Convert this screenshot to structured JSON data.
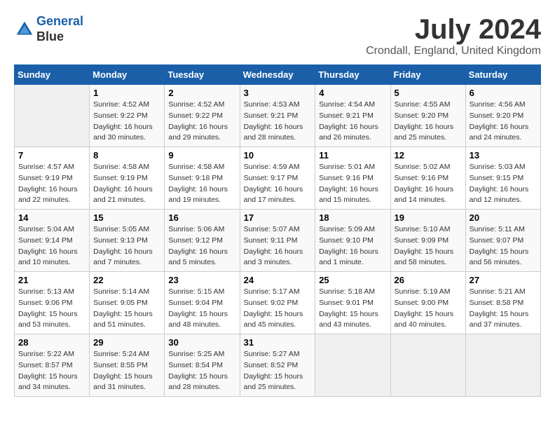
{
  "header": {
    "logo_line1": "General",
    "logo_line2": "Blue",
    "title": "July 2024",
    "location": "Crondall, England, United Kingdom"
  },
  "days_of_week": [
    "Sunday",
    "Monday",
    "Tuesday",
    "Wednesday",
    "Thursday",
    "Friday",
    "Saturday"
  ],
  "weeks": [
    [
      {
        "day": "",
        "empty": true
      },
      {
        "day": "1",
        "sunrise": "Sunrise: 4:52 AM",
        "sunset": "Sunset: 9:22 PM",
        "daylight": "Daylight: 16 hours and 30 minutes."
      },
      {
        "day": "2",
        "sunrise": "Sunrise: 4:52 AM",
        "sunset": "Sunset: 9:22 PM",
        "daylight": "Daylight: 16 hours and 29 minutes."
      },
      {
        "day": "3",
        "sunrise": "Sunrise: 4:53 AM",
        "sunset": "Sunset: 9:21 PM",
        "daylight": "Daylight: 16 hours and 28 minutes."
      },
      {
        "day": "4",
        "sunrise": "Sunrise: 4:54 AM",
        "sunset": "Sunset: 9:21 PM",
        "daylight": "Daylight: 16 hours and 26 minutes."
      },
      {
        "day": "5",
        "sunrise": "Sunrise: 4:55 AM",
        "sunset": "Sunset: 9:20 PM",
        "daylight": "Daylight: 16 hours and 25 minutes."
      },
      {
        "day": "6",
        "sunrise": "Sunrise: 4:56 AM",
        "sunset": "Sunset: 9:20 PM",
        "daylight": "Daylight: 16 hours and 24 minutes."
      }
    ],
    [
      {
        "day": "7",
        "sunrise": "Sunrise: 4:57 AM",
        "sunset": "Sunset: 9:19 PM",
        "daylight": "Daylight: 16 hours and 22 minutes."
      },
      {
        "day": "8",
        "sunrise": "Sunrise: 4:58 AM",
        "sunset": "Sunset: 9:19 PM",
        "daylight": "Daylight: 16 hours and 21 minutes."
      },
      {
        "day": "9",
        "sunrise": "Sunrise: 4:58 AM",
        "sunset": "Sunset: 9:18 PM",
        "daylight": "Daylight: 16 hours and 19 minutes."
      },
      {
        "day": "10",
        "sunrise": "Sunrise: 4:59 AM",
        "sunset": "Sunset: 9:17 PM",
        "daylight": "Daylight: 16 hours and 17 minutes."
      },
      {
        "day": "11",
        "sunrise": "Sunrise: 5:01 AM",
        "sunset": "Sunset: 9:16 PM",
        "daylight": "Daylight: 16 hours and 15 minutes."
      },
      {
        "day": "12",
        "sunrise": "Sunrise: 5:02 AM",
        "sunset": "Sunset: 9:16 PM",
        "daylight": "Daylight: 16 hours and 14 minutes."
      },
      {
        "day": "13",
        "sunrise": "Sunrise: 5:03 AM",
        "sunset": "Sunset: 9:15 PM",
        "daylight": "Daylight: 16 hours and 12 minutes."
      }
    ],
    [
      {
        "day": "14",
        "sunrise": "Sunrise: 5:04 AM",
        "sunset": "Sunset: 9:14 PM",
        "daylight": "Daylight: 16 hours and 10 minutes."
      },
      {
        "day": "15",
        "sunrise": "Sunrise: 5:05 AM",
        "sunset": "Sunset: 9:13 PM",
        "daylight": "Daylight: 16 hours and 7 minutes."
      },
      {
        "day": "16",
        "sunrise": "Sunrise: 5:06 AM",
        "sunset": "Sunset: 9:12 PM",
        "daylight": "Daylight: 16 hours and 5 minutes."
      },
      {
        "day": "17",
        "sunrise": "Sunrise: 5:07 AM",
        "sunset": "Sunset: 9:11 PM",
        "daylight": "Daylight: 16 hours and 3 minutes."
      },
      {
        "day": "18",
        "sunrise": "Sunrise: 5:09 AM",
        "sunset": "Sunset: 9:10 PM",
        "daylight": "Daylight: 16 hours and 1 minute."
      },
      {
        "day": "19",
        "sunrise": "Sunrise: 5:10 AM",
        "sunset": "Sunset: 9:09 PM",
        "daylight": "Daylight: 15 hours and 58 minutes."
      },
      {
        "day": "20",
        "sunrise": "Sunrise: 5:11 AM",
        "sunset": "Sunset: 9:07 PM",
        "daylight": "Daylight: 15 hours and 56 minutes."
      }
    ],
    [
      {
        "day": "21",
        "sunrise": "Sunrise: 5:13 AM",
        "sunset": "Sunset: 9:06 PM",
        "daylight": "Daylight: 15 hours and 53 minutes."
      },
      {
        "day": "22",
        "sunrise": "Sunrise: 5:14 AM",
        "sunset": "Sunset: 9:05 PM",
        "daylight": "Daylight: 15 hours and 51 minutes."
      },
      {
        "day": "23",
        "sunrise": "Sunrise: 5:15 AM",
        "sunset": "Sunset: 9:04 PM",
        "daylight": "Daylight: 15 hours and 48 minutes."
      },
      {
        "day": "24",
        "sunrise": "Sunrise: 5:17 AM",
        "sunset": "Sunset: 9:02 PM",
        "daylight": "Daylight: 15 hours and 45 minutes."
      },
      {
        "day": "25",
        "sunrise": "Sunrise: 5:18 AM",
        "sunset": "Sunset: 9:01 PM",
        "daylight": "Daylight: 15 hours and 43 minutes."
      },
      {
        "day": "26",
        "sunrise": "Sunrise: 5:19 AM",
        "sunset": "Sunset: 9:00 PM",
        "daylight": "Daylight: 15 hours and 40 minutes."
      },
      {
        "day": "27",
        "sunrise": "Sunrise: 5:21 AM",
        "sunset": "Sunset: 8:58 PM",
        "daylight": "Daylight: 15 hours and 37 minutes."
      }
    ],
    [
      {
        "day": "28",
        "sunrise": "Sunrise: 5:22 AM",
        "sunset": "Sunset: 8:57 PM",
        "daylight": "Daylight: 15 hours and 34 minutes."
      },
      {
        "day": "29",
        "sunrise": "Sunrise: 5:24 AM",
        "sunset": "Sunset: 8:55 PM",
        "daylight": "Daylight: 15 hours and 31 minutes."
      },
      {
        "day": "30",
        "sunrise": "Sunrise: 5:25 AM",
        "sunset": "Sunset: 8:54 PM",
        "daylight": "Daylight: 15 hours and 28 minutes."
      },
      {
        "day": "31",
        "sunrise": "Sunrise: 5:27 AM",
        "sunset": "Sunset: 8:52 PM",
        "daylight": "Daylight: 15 hours and 25 minutes."
      },
      {
        "day": "",
        "empty": true
      },
      {
        "day": "",
        "empty": true
      },
      {
        "day": "",
        "empty": true
      }
    ]
  ]
}
